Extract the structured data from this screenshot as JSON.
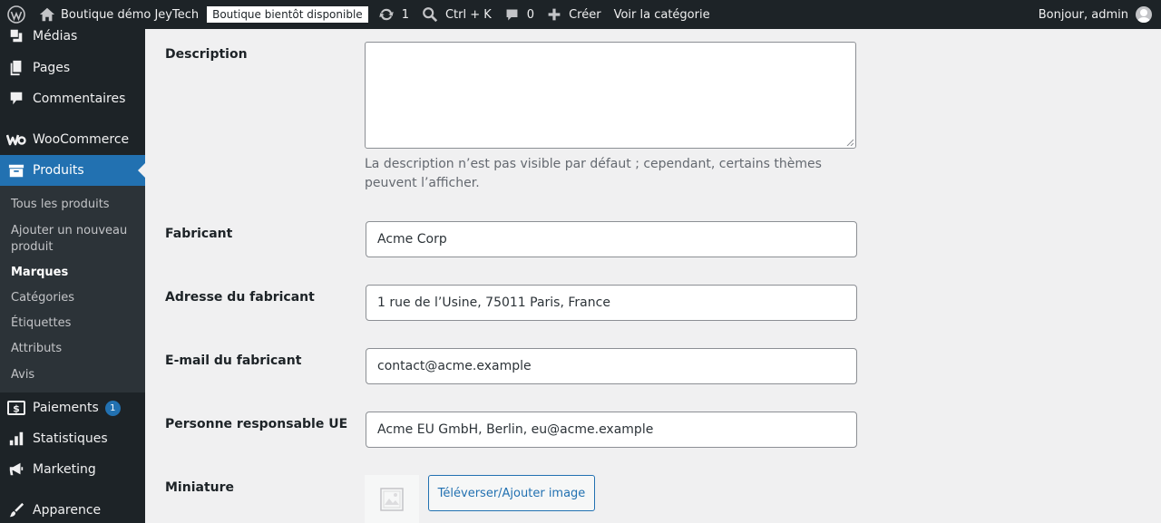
{
  "adminbar": {
    "site_name": "Boutique démo JeyTech",
    "store_badge": "Boutique bientôt disponible",
    "updates_count": "1",
    "search_shortcut": "Ctrl + K",
    "comments_count": "0",
    "create_label": "Créer",
    "view_category_label": "Voir la catégorie",
    "greeting": "Bonjour, admin"
  },
  "sidebar": {
    "items": {
      "media": "Médias",
      "pages": "Pages",
      "comments": "Commentaires",
      "woocommerce": "WooCommerce",
      "products": "Produits",
      "payments": "Paiements",
      "payments_badge": "1",
      "analytics": "Statistiques",
      "marketing": "Marketing",
      "appearance": "Apparence"
    },
    "submenu": {
      "all_products": "Tous les produits",
      "add_new": "Ajouter un nouveau produit",
      "brands": "Marques",
      "categories": "Catégories",
      "tags": "Étiquettes",
      "attributes": "Attributs",
      "reviews": "Avis"
    }
  },
  "form": {
    "description_label": "Description",
    "description_value": "",
    "description_help": "La description n’est pas visible par défaut ; cependant, certains thèmes peuvent l’afficher.",
    "manufacturer_label": "Fabricant",
    "manufacturer_value": "Acme Corp",
    "manufacturer_address_label": "Adresse du fabricant",
    "manufacturer_address_value": "1 rue de l’Usine, 75011 Paris, France",
    "manufacturer_email_label": "E-mail du fabricant",
    "manufacturer_email_value": "contact@acme.example",
    "eu_responsible_label": "Personne responsable UE",
    "eu_responsible_value": "Acme EU GmbH, Berlin, eu@acme.example",
    "thumbnail_label": "Miniature",
    "upload_button": "Téléverser/Ajouter image"
  },
  "colors": {
    "admin_bar": "#1d2327",
    "sidebar": "#1d2327",
    "submenu": "#2c3338",
    "accent": "#2271b1",
    "background": "#f0f0f1"
  }
}
